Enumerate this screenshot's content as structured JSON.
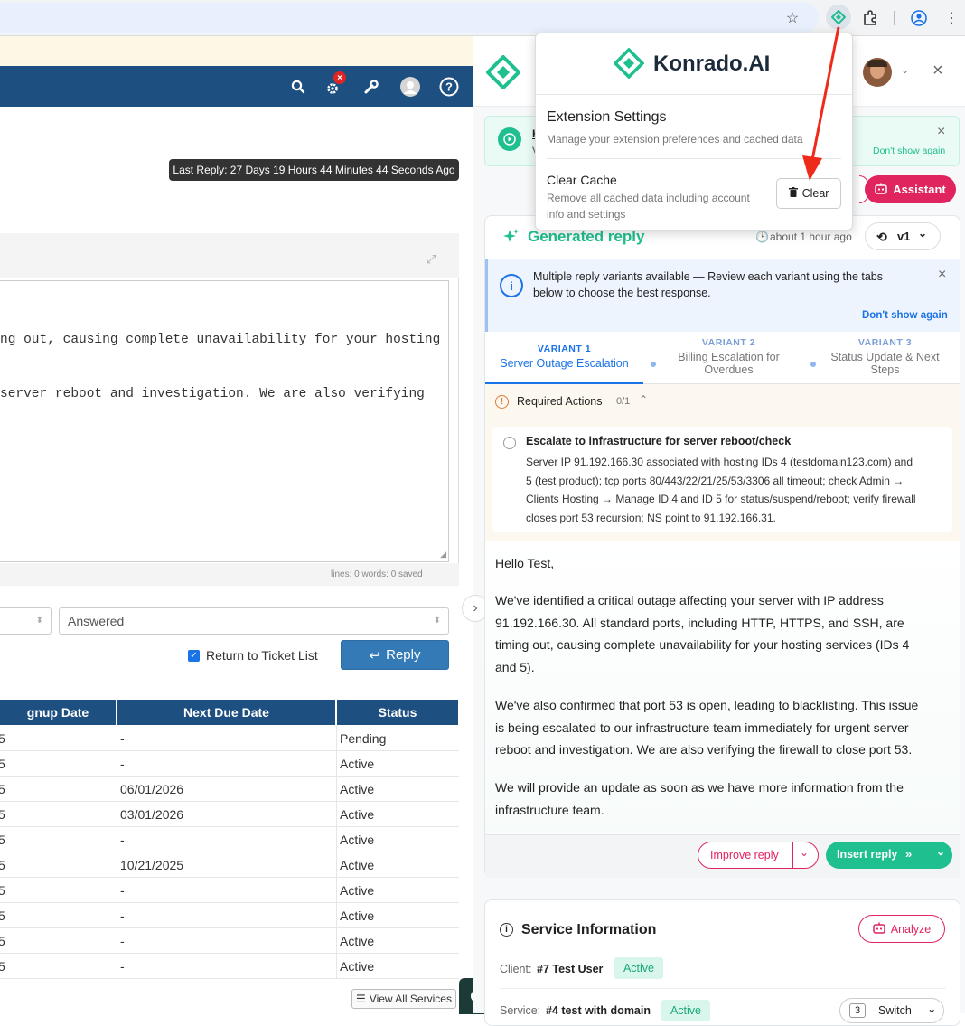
{
  "left": {
    "last_reply": "Last Reply: 27 Days 19 Hours 44 Minutes 44 Seconds Ago",
    "editor_line1": "ng out, causing complete unavailability for your hosting",
    "editor_line2": "server reboot and investigation. We are also verifying",
    "editor_stats": "lines: 0  words: 0  saved",
    "status_select": "Answered",
    "return_label": "Return to Ticket List",
    "reply_label": "Reply",
    "table_headers": [
      "gnup Date",
      "Next Due Date",
      "Status"
    ],
    "rows": [
      {
        "a": "5",
        "due": "-",
        "status": "Pending"
      },
      {
        "a": "5",
        "due": "-",
        "status": "Active"
      },
      {
        "a": "5",
        "due": "06/01/2026",
        "status": "Active"
      },
      {
        "a": "5",
        "due": "03/01/2026",
        "status": "Active"
      },
      {
        "a": "5",
        "due": "-",
        "status": "Active"
      },
      {
        "a": "5",
        "due": "10/21/2025",
        "status": "Active"
      },
      {
        "a": "5",
        "due": "-",
        "status": "Active"
      },
      {
        "a": "5",
        "due": "-",
        "status": "Active"
      },
      {
        "a": "5",
        "due": "-",
        "status": "Active"
      },
      {
        "a": "5",
        "due": "-",
        "status": "Active"
      }
    ],
    "view_all": "View All Services"
  },
  "popup": {
    "brand": "Konrado.AI",
    "title": "Extension Settings",
    "subtitle": "Manage your extension preferences and cached data",
    "cache_title": "Clear Cache",
    "cache_desc_1": "Remove all cached data including account",
    "cache_desc_2": "info and settings",
    "clear_label": "Clear"
  },
  "panel": {
    "banner_dismiss": "Don't show again",
    "banner_title_fragment": "H",
    "banner_sub_fragment": "V",
    "assistant_label": "Assistant",
    "generated_title": "Generated reply",
    "time_ago": "about 1 hour ago",
    "version": "v1",
    "variants_info_1": "Multiple reply variants available — Review each variant using the tabs",
    "variants_info_2": "below to choose the best response.",
    "variants_dismiss": "Don't show again",
    "tabs": [
      {
        "label": "VARIANT 1",
        "title": "Server Outage Escalation"
      },
      {
        "label": "VARIANT 2",
        "title1": "Billing Escalation for",
        "title2": "Overdues"
      },
      {
        "label": "VARIANT 3",
        "title1": "Status Update & Next",
        "title2": "Steps"
      }
    ],
    "required_actions": "Required Actions",
    "required_count": "0/1",
    "action_title": "Escalate to infrastructure for server reboot/check",
    "action_lines": [
      "Server IP 91.192.166.30 associated with hosting IDs 4 (testdomain123.com) and",
      "5 (test product); tcp ports 80/443/22/21/25/53/3306 all timeout; check Admin →",
      "Clients Hosting → Manage ID 4 and ID 5 for status/suspend/reboot; verify firewall",
      "closes port 53 recursion; NS point to 91.192.166.31."
    ],
    "reply_greeting": "Hello Test,",
    "reply_p1": [
      "We've identified a critical outage affecting your server with IP address",
      "91.192.166.30. All standard ports, including HTTP, HTTPS, and SSH, are",
      "timing out, causing complete unavailability for your hosting services (IDs 4",
      "and 5)."
    ],
    "reply_p2": [
      "We've also confirmed that port 53 is open, leading to blacklisting. This issue",
      "is being escalated to our infrastructure team immediately for urgent server",
      "reboot and investigation. We are also verifying the firewall to close port 53."
    ],
    "reply_p3": [
      "We will provide an update as soon as we have more information from the",
      "infrastructure team."
    ],
    "improve_label": "Improve reply",
    "insert_label": "Insert reply",
    "service_title": "Service Information",
    "analyze_label": "Analyze",
    "client_label": "Client:",
    "client_value": "#7 Test User",
    "client_status": "Active",
    "service_label": "Service:",
    "service_value": "#4 test with domain",
    "service_status": "Active",
    "switch_count": "3",
    "switch_label": "Switch"
  },
  "colors": {
    "nav": "#1d4f80",
    "brand_green": "#1fbf8f",
    "accent_pink": "#e0245e",
    "variant_blue": "#1a73e8"
  }
}
